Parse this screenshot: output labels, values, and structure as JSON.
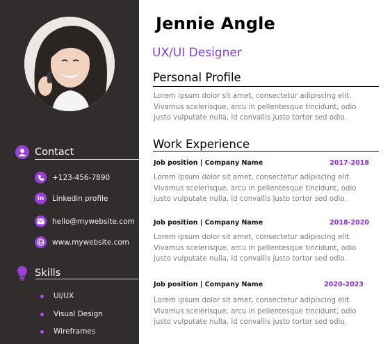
{
  "profile": {
    "name": "Jennie Angle",
    "title": "UX/UI Designer"
  },
  "contact": {
    "heading": "Contact",
    "items": [
      {
        "icon": "phone-icon",
        "text": "+123-456-7890"
      },
      {
        "icon": "linkedin-icon",
        "text": "Linkedin profile"
      },
      {
        "icon": "email-icon",
        "text": "hello@mywebsite.com"
      },
      {
        "icon": "globe-icon",
        "text": "www.mywebsite.com"
      }
    ]
  },
  "skills": {
    "heading": "Skills",
    "items": [
      "UI/UX",
      "Visual Design",
      "Wireframes"
    ]
  },
  "personal_profile": {
    "heading": "Personal Profile",
    "lines": [
      "Lorem ipsum dolor sit amet, consectetur adipiscing elit.",
      "Vivamus scelerisque, arcu in pellentesque tincidunt, odio",
      "justo vulputate nulla, id convallis justo tortor sed odio."
    ]
  },
  "work_experience": {
    "heading": "Work Experience",
    "jobs": [
      {
        "position": "Job position | Company Name",
        "dates": "2017-2018",
        "lines": [
          "Lorem ipsum dolor sit amet, consectetur adipiscing elit.",
          "Vivamus scelerisque, arcu in pellentesque tincidunt, odio",
          "justo vulputate nulla, id convallis justo tortor sed odio."
        ]
      },
      {
        "position": "Job position | Company Name",
        "dates": "2018-2020",
        "lines": [
          "Lorem ipsum dolor sit amet, consectetur adipiscing elit.",
          "Vivamus scelerisque, arcu in pellentesque tincidunt, odio",
          "justo vulputate nulla, id convallis justo tortor sed odio."
        ]
      },
      {
        "position": "Job position | Company Name",
        "dates": "2020-2023",
        "lines": [
          "Lorem ipsum dolor sit amet, consectetur adipiscing elit.",
          "Vivamus scelerisque, arcu in pellentesque tincidunt, odio",
          "justo vulputate nulla, id convallis justo tortor sed odio."
        ]
      }
    ]
  },
  "colors": {
    "sidebar": "#312d2d",
    "accent": "#9b3fdc",
    "date_accent": "#8a2be2",
    "body_text": "#7c7c7c"
  }
}
